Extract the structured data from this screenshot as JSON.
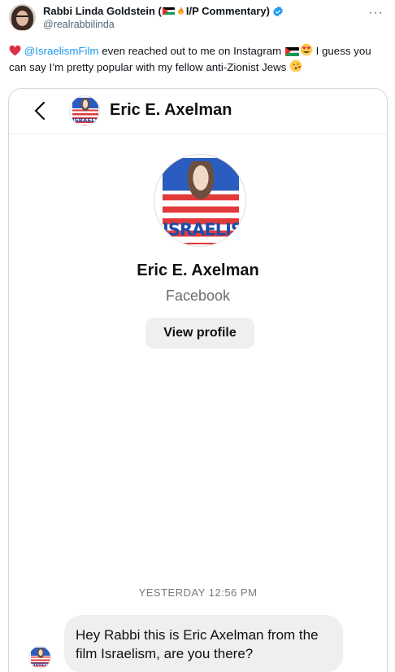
{
  "tweet": {
    "author_name": "Rabbi Linda Goldstein (",
    "author_name_suffix": "I/P Commentary)",
    "handle": "@realrabbilinda",
    "more_label": "···",
    "text_mention": "@IsraelismFilm",
    "text_part1": " even reached out to me on Instagram ",
    "text_part2": " I guess you can say I’m pretty popular with my fellow anti-Zionist Jews ",
    "icons": [
      "heart-icon",
      "palestine-flag-icon",
      "fire-icon",
      "verified-badge-icon",
      "heart-eyes-icon",
      "kiss-icon"
    ]
  },
  "instagram": {
    "header_name": "Eric E. Axelman",
    "profile_name": "Eric E. Axelman",
    "profile_subtitle": "Facebook",
    "view_profile_label": "View profile",
    "logo_word": "ISRAELISM",
    "timestamp": "YESTERDAY 12:56 PM",
    "message": "Hey Rabbi this is Eric Axelman from the film Israelism, are you there?",
    "colors": {
      "bubble": "#efefef",
      "logo_blue": "#2a5dbf",
      "logo_red": "#e23a3a"
    }
  }
}
